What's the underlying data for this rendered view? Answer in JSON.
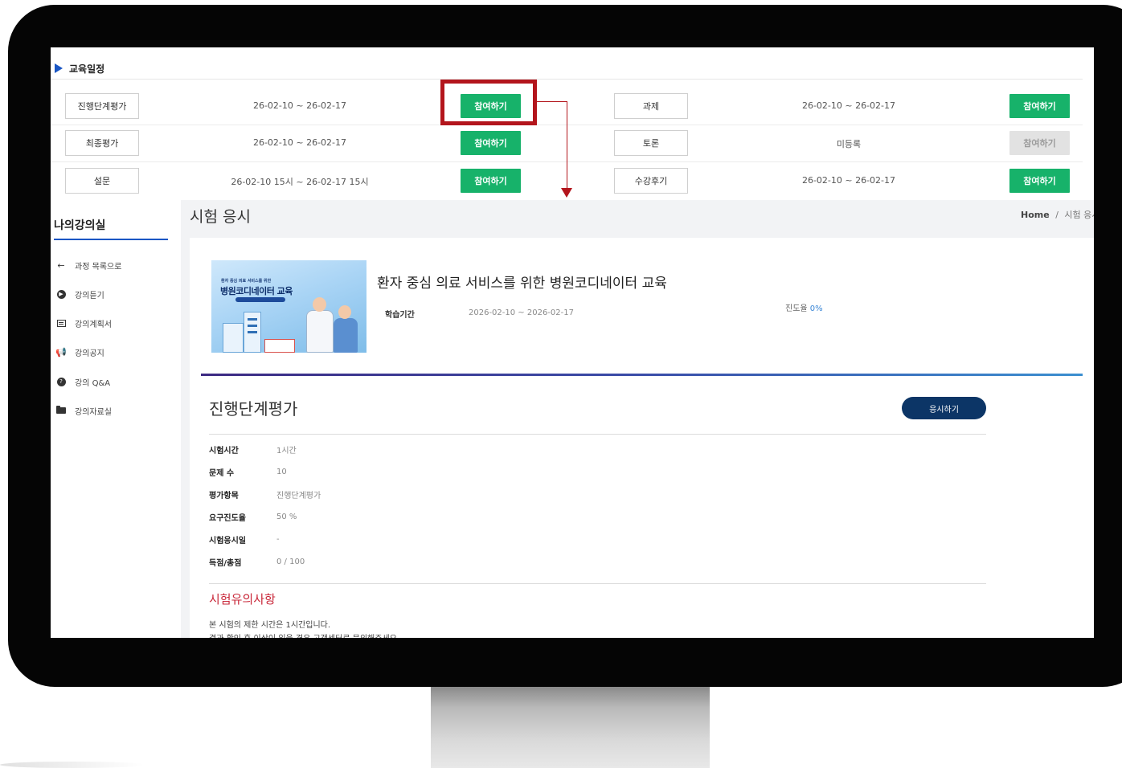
{
  "schedule": {
    "title": "교육일정",
    "rows": [
      {
        "left_label": "진행단계평가",
        "left_period": "26-02-10 ~ 26-02-17",
        "left_action": "참여하기",
        "right_label": "과제",
        "right_period": "26-02-10 ~ 26-02-17",
        "right_action": "참여하기"
      },
      {
        "left_label": "최종평가",
        "left_period": "26-02-10 ~ 26-02-17",
        "left_action": "참여하기",
        "right_label": "토론",
        "right_period": "미등록",
        "right_action": "참여하기"
      },
      {
        "left_label": "설문",
        "left_period": "26-02-10 15시 ~ 26-02-17 15시",
        "left_action": "참여하기",
        "right_label": "수강후기",
        "right_period": "26-02-10 ~ 26-02-17",
        "right_action": "참여하기"
      }
    ]
  },
  "sidebar": {
    "title": "나의강의실",
    "items": [
      {
        "label": "과정 목록으로",
        "icon": "arrow-left-icon"
      },
      {
        "label": "강의듣기",
        "icon": "play-circle-icon"
      },
      {
        "label": "강의계획서",
        "icon": "table-icon"
      },
      {
        "label": "강의공지",
        "icon": "megaphone-icon"
      },
      {
        "label": "강의 Q&A",
        "icon": "question-circle-icon"
      },
      {
        "label": "강의자료실",
        "icon": "folder-icon"
      }
    ]
  },
  "page": {
    "title": "시험 응시",
    "breadcrumb_home": "Home",
    "breadcrumb_sep": "/",
    "breadcrumb_current": "시험 응시"
  },
  "course": {
    "thumb_small": "환자 중심 의료 서비스를 위한",
    "thumb_title": "병원코디네이터 교육",
    "title": "환자 중심 의료 서비스를 위한 병원코디네이터 교육",
    "study_label": "학습기간",
    "study_period": "2026-02-10 ~ 2026-02-17",
    "progress_label": "진도율",
    "progress_value": "0%"
  },
  "exam": {
    "title": "진행단계평가",
    "button": "응시하기",
    "info": [
      {
        "key": "시험시간",
        "value": "1시간"
      },
      {
        "key": "문제 수",
        "value": "10"
      },
      {
        "key": "평가항목",
        "value": "진행단계평가"
      },
      {
        "key": "요구진도율",
        "value": "50 %"
      },
      {
        "key": "시험응시일",
        "value": "-"
      },
      {
        "key": "득점/총점",
        "value": "0 / 100"
      }
    ]
  },
  "notice": {
    "title": "시험유의사항",
    "line1": "본 시험의 제한 시간은 1시간입니다.",
    "line2": "결과 확인 후 이상이 있을 경우 고객센터로 문의해주세요."
  },
  "colors": {
    "accent_green": "#17b26a",
    "highlight_red": "#b3151c",
    "navy_button": "#0c3566",
    "notice_red": "#c9283a",
    "link_blue": "#3a86d6"
  }
}
